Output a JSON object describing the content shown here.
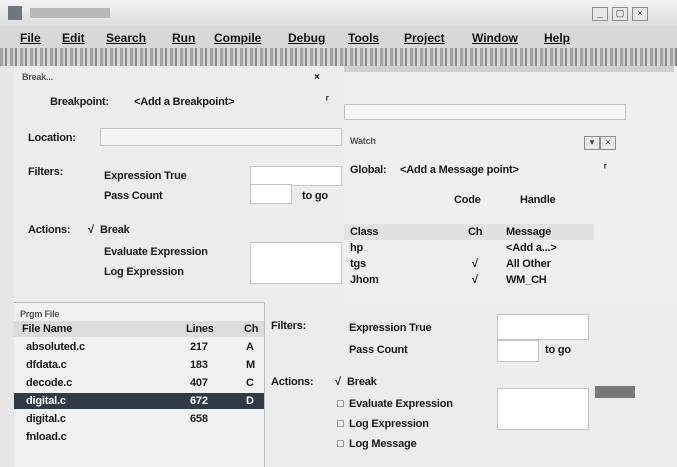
{
  "window": {
    "title": "",
    "controls": [
      "_",
      "▢",
      "×"
    ]
  },
  "menubar": {
    "items": [
      "File",
      "Edit",
      "Search",
      "Run",
      "Compile",
      "Debug",
      "Tools",
      "Project",
      "Window",
      "Help"
    ]
  },
  "breakpoint_panel": {
    "title": "Break...",
    "breakpoint_label": "Breakpoint:",
    "breakpoint_value": "<Add a Breakpoint>",
    "location_label": "Location:",
    "filters_label": "Filters:",
    "expression_true": "Expression True",
    "pass_count": "Pass Count",
    "pass_count_suffix": "to go",
    "actions_label": "Actions:",
    "action_break": "Break",
    "action_evaluate": "Evaluate Expression",
    "action_log": "Log Expression"
  },
  "watch_panel": {
    "title": "Watch",
    "global_label": "Global:",
    "global_value": "<Add a Message point>",
    "code_option": "Code",
    "handle_option": "Handle",
    "columns": [
      "Class",
      "Ch",
      "Message"
    ],
    "rows": [
      {
        "class": "hp",
        "ch": "",
        "message": "<Add a...>"
      },
      {
        "class": "tgs",
        "ch": "√",
        "message": "All Other"
      },
      {
        "class": "Jhom",
        "ch": "√",
        "message": "WM_CH"
      }
    ]
  },
  "files_panel": {
    "title": "Prgm File",
    "columns": [
      "File Name",
      "Lines",
      "Ch"
    ],
    "rows": [
      {
        "name": "absoluted.c",
        "lines": "217",
        "flag": "A"
      },
      {
        "name": "dfdata.c",
        "lines": "183",
        "flag": "M"
      },
      {
        "name": "decode.c",
        "lines": "407",
        "flag": "C"
      },
      {
        "name": "digital.c",
        "lines": "672",
        "flag": "D"
      },
      {
        "name": "digital.c",
        "lines": "658",
        "flag": ""
      },
      {
        "name": "fnload.c",
        "lines": "",
        "flag": ""
      }
    ],
    "selected_index": 3
  },
  "bp_dialog": {
    "filters_label": "Filters:",
    "expression_true": "Expression True",
    "pass_count": "Pass Count",
    "pass_count_suffix": "to go",
    "actions_label": "Actions:",
    "action_break": "Break",
    "action_evaluate": "Evaluate Expression",
    "action_log_expression": "Log Expression",
    "action_log_message": "Log Message"
  }
}
